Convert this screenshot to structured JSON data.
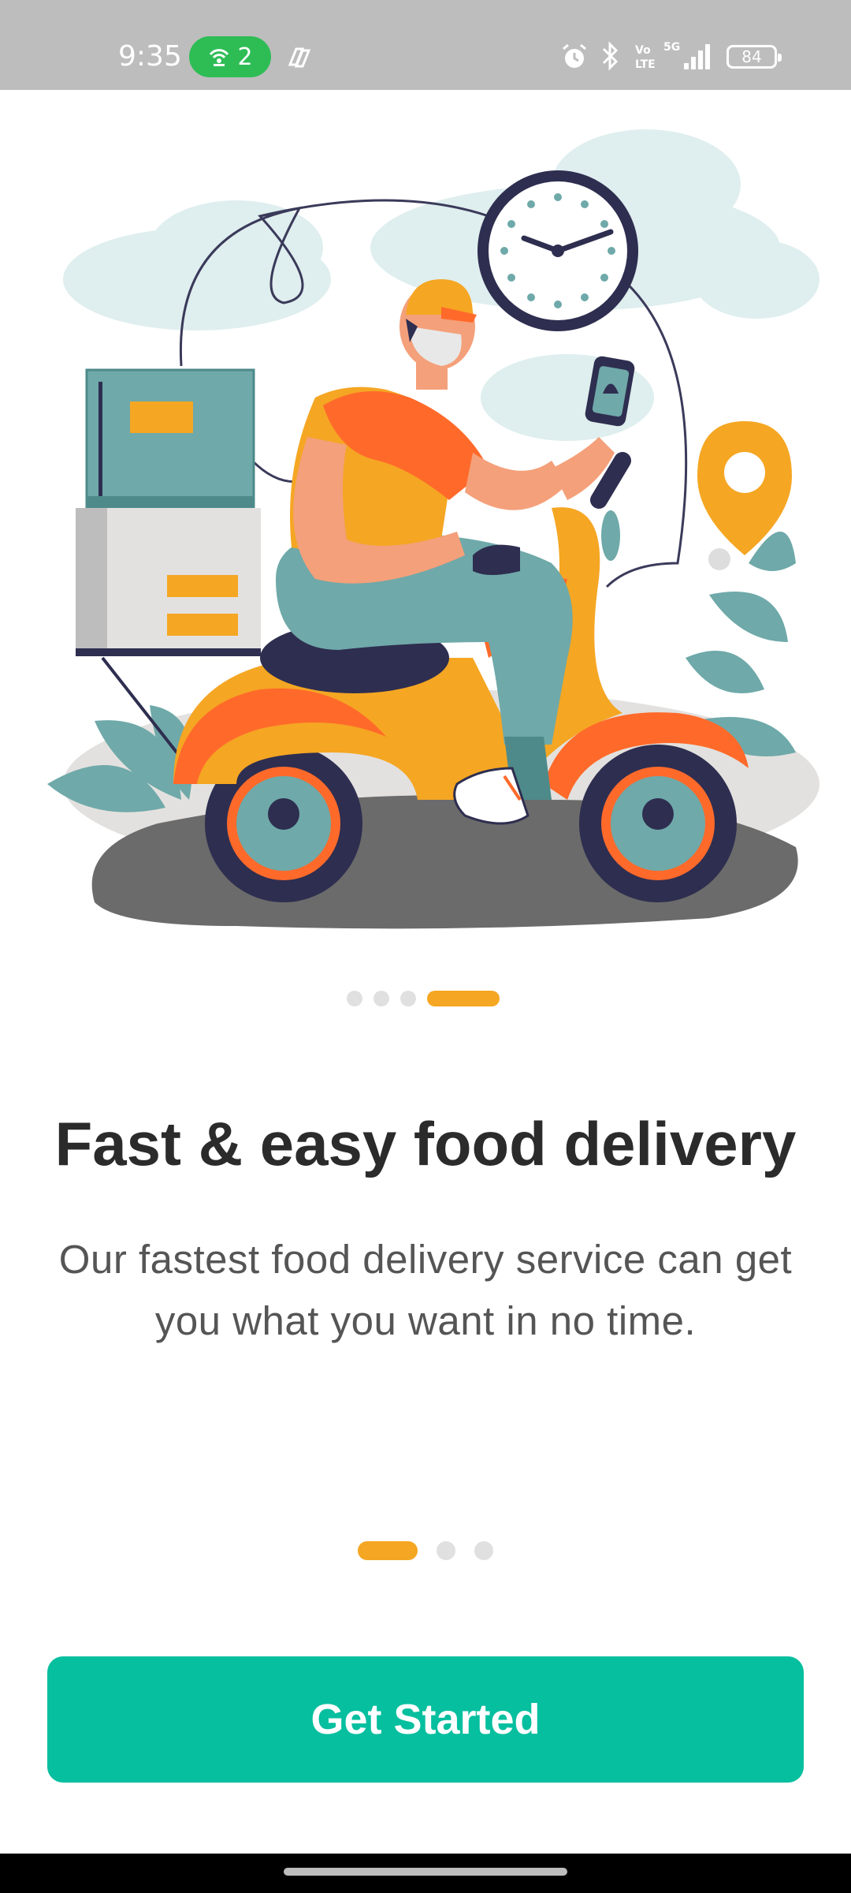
{
  "status_bar": {
    "time": "9:35",
    "hotspot_count": "2",
    "battery": "84",
    "icons": [
      "hotspot-icon",
      "copilot-icon",
      "alarm-icon",
      "bluetooth-icon",
      "volte-icon",
      "5g-signal-icon",
      "battery-icon"
    ]
  },
  "onboarding": {
    "image_indicator": {
      "count": 4,
      "active_index": 3
    },
    "title": "Fast & easy food delivery",
    "subtitle": "Our fastest food delivery service can get you what you want in no time.",
    "page_indicator": {
      "count": 3,
      "active_index": 0
    }
  },
  "actions": {
    "get_started_label": "Get Started"
  },
  "colors": {
    "accent": "#f5a623",
    "primary_button": "#06bf9f",
    "status_bar_bg": "#bdbdbd",
    "hotspot_pill": "#2ebd55"
  }
}
